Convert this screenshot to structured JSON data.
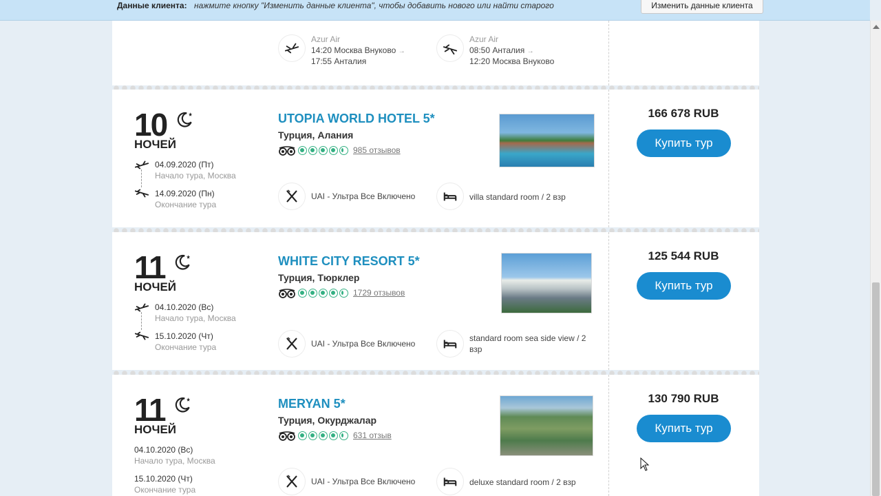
{
  "client_bar": {
    "label": "Данные клиента:",
    "hint": "нажмите кнопку \"Изменить данные клиента\", чтобы добавить нового или найти старого",
    "button": "Изменить данные клиента"
  },
  "top_card": {
    "outbound": {
      "airline": "Azur Air",
      "line1": "14:20 Москва Внуково",
      "line2": "17:55 Анталия"
    },
    "inbound": {
      "airline": "Azur Air",
      "line1": "08:50 Анталия",
      "line2": "12:20 Москва Внуково"
    }
  },
  "tours": [
    {
      "nights_num": "10",
      "nights_word": "НОЧЕЙ",
      "start_date": "04.09.2020 (Пт)",
      "start_sub": "Начало тура, Москва",
      "end_date": "14.09.2020 (Пн)",
      "end_sub": "Окончание тура",
      "hotel": "UTOPIA WORLD HOTEL 5*",
      "location": "Турция, Алания",
      "rating": 4.5,
      "reviews": "985 отзывов",
      "meal": "UAI - Ультра Все Включено",
      "room": "villa standard room / 2 взр",
      "price": "166 678 RUB",
      "buy": "Купить тур"
    },
    {
      "nights_num": "11",
      "nights_word": "НОЧЕЙ",
      "start_date": "04.10.2020 (Вс)",
      "start_sub": "Начало тура, Москва",
      "end_date": "15.10.2020 (Чт)",
      "end_sub": "Окончание тура",
      "hotel": "WHITE CITY RESORT 5*",
      "location": "Турция, Тюрклер",
      "rating": 4.5,
      "reviews": "1729 отзывов",
      "meal": "UAI - Ультра Все Включено",
      "room": "standard room sea side view / 2 взр",
      "price": "125 544 RUB",
      "buy": "Купить тур"
    },
    {
      "nights_num": "11",
      "nights_word": "НОЧЕЙ",
      "start_date": "04.10.2020 (Вс)",
      "start_sub": "Начало тура, Москва",
      "end_date": "15.10.2020 (Чт)",
      "end_sub": "Окончание тура",
      "hotel": "MERYAN 5*",
      "location": "Турция, Окурджалар",
      "rating": 4.5,
      "reviews": "631 отзыв",
      "meal": "UAI - Ультра Все Включено",
      "room": "deluxe standard room / 2 взр",
      "price": "130 790 RUB",
      "buy": "Купить тур"
    }
  ],
  "colors": {
    "accent": "#1a8cd0",
    "hotel_link": "#1e8fbf",
    "rating": "#34b083",
    "client_bar": "#c7e3f7"
  }
}
